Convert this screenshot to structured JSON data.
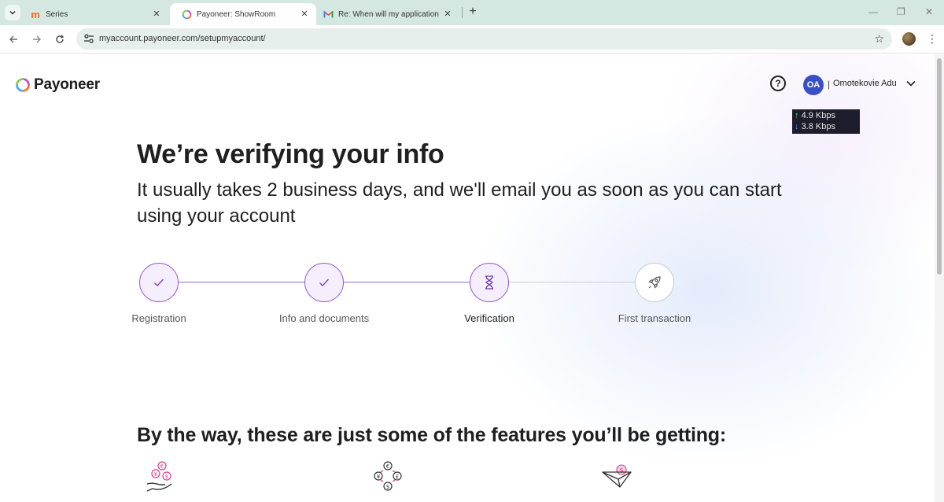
{
  "browser": {
    "tabs": [
      {
        "title": "Series",
        "icon": "m-logo-icon",
        "active": false
      },
      {
        "title": "Payoneer: ShowRoom",
        "icon": "payoneer-ring-icon",
        "active": true
      },
      {
        "title": "Re: When will my application b",
        "icon": "gmail-icon",
        "active": false
      }
    ],
    "url": "myaccount.payoneer.com/setupmyaccount/"
  },
  "header": {
    "brand": "Payoneer",
    "user_initials": "OA",
    "user_separator": "|",
    "user_name": "Omotekovie Adu"
  },
  "netspeed": {
    "upload": "4.9 Kbps",
    "download": "3.8 Kbps"
  },
  "main": {
    "title": "We’re verifying your info",
    "subtitle": "It usually takes 2 business days, and we'll email you as soon as you can start using your account",
    "steps": [
      {
        "label": "Registration",
        "status": "done",
        "icon": "check-icon"
      },
      {
        "label": "Info and documents",
        "status": "done",
        "icon": "check-icon"
      },
      {
        "label": "Verification",
        "status": "current",
        "icon": "hourglass-icon"
      },
      {
        "label": "First transaction",
        "status": "pending",
        "icon": "rocket-icon"
      }
    ],
    "features_heading": "By the way, these are just some of the features you’ll be getting:",
    "features": [
      {
        "icon": "hand-currency-icon"
      },
      {
        "icon": "currency-exchange-icon"
      },
      {
        "icon": "paper-plane-dollar-icon"
      }
    ]
  },
  "colors": {
    "accent_purple": "#8f58d4",
    "avatar_blue": "#3b4fc4",
    "pending_gray": "#c9c9c9"
  }
}
